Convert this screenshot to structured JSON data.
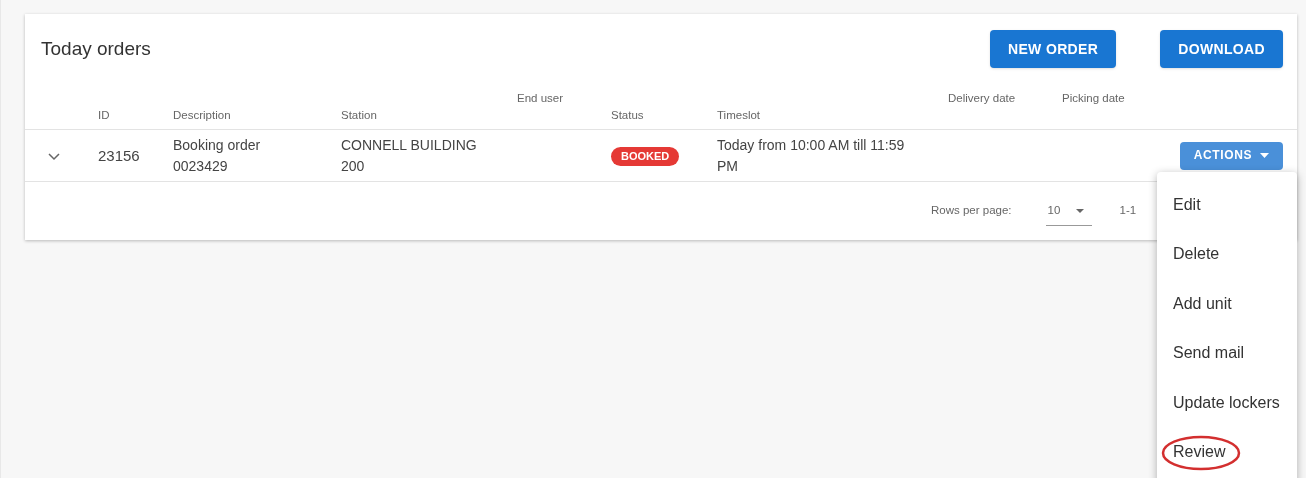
{
  "title": "Today orders",
  "header_buttons": [
    "NEW ORDER",
    "DOWNLOAD"
  ],
  "columns": [
    "ID",
    "Description",
    "Station",
    "End user",
    "Status",
    "Timeslot",
    "Delivery date",
    "Picking date"
  ],
  "rows": [
    {
      "expanded": false,
      "id": "23156",
      "description": "Booking order 0023429",
      "station": "CONNELL BUILDING 200",
      "status": {
        "label": "BOOKED",
        "color": "#e53935"
      },
      "timeslot": "Today from 10:00 AM till 11:59 PM",
      "action_button": "ACTIONS"
    }
  ],
  "pagination": {
    "rows_per_page_label": "Rows per page:",
    "rows_per_page": "10",
    "range": "1-1"
  },
  "actions_menu": {
    "open": true,
    "items": [
      {
        "label": "Edit",
        "circled": false
      },
      {
        "label": "Delete",
        "circled": false
      },
      {
        "label": "Add unit",
        "circled": false
      },
      {
        "label": "Send mail",
        "circled": false
      },
      {
        "label": "Update lockers",
        "circled": false
      },
      {
        "label": "Review",
        "circled": true
      }
    ]
  }
}
